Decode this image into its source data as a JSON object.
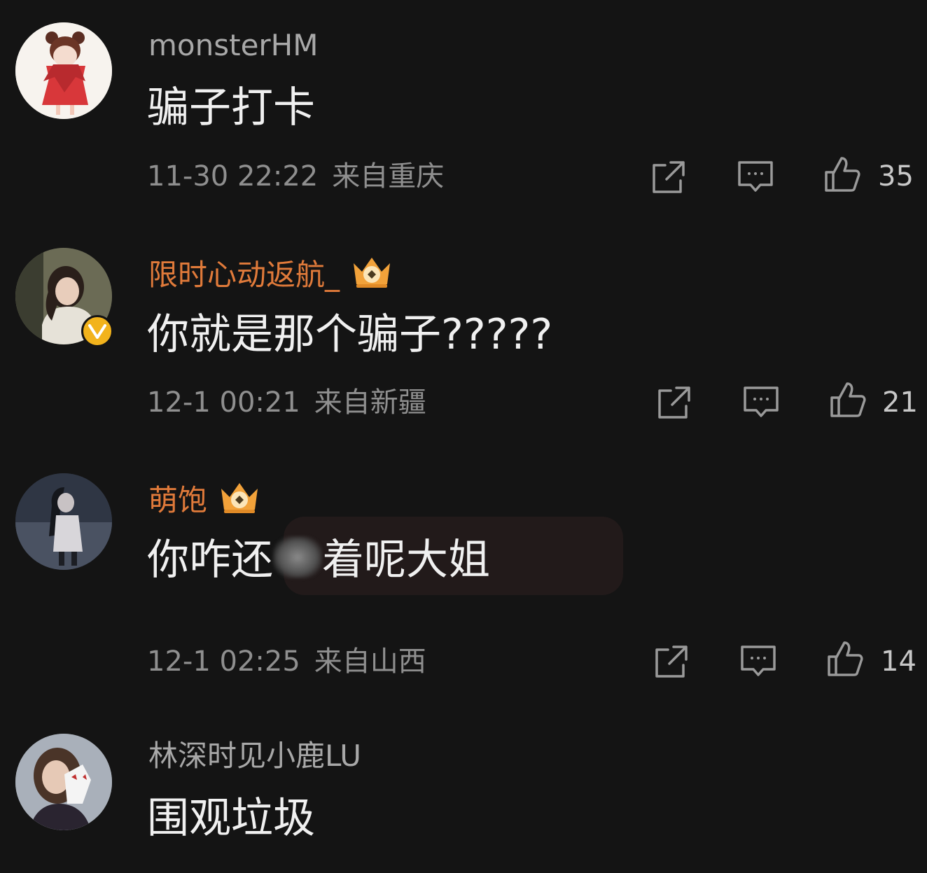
{
  "colors": {
    "background": "#141414",
    "name_default": "#a8a8a8",
    "name_vip": "#e07a3a",
    "text": "#f0f0f0",
    "meta": "#8f8f8f"
  },
  "comments": [
    {
      "username": "monsterHM",
      "vip": false,
      "verified": false,
      "text": "骗子打卡",
      "time": "11-30 22:22",
      "location": "来自重庆",
      "likes": "35"
    },
    {
      "username": "限时心动返航_",
      "vip": true,
      "verified": true,
      "text": "你就是那个骗子?????",
      "time": "12-1 00:21",
      "location": "来自新疆",
      "likes": "21"
    },
    {
      "username": "萌饱",
      "vip": true,
      "verified": false,
      "text_before_blur": "你咋还",
      "text_after_blur": "着呢大姐",
      "time": "12-1 02:25",
      "location": "来自山西",
      "likes": "14"
    },
    {
      "username": "林深时见小鹿LU",
      "vip": false,
      "verified": false,
      "text": "围观垃圾"
    }
  ],
  "icons": {
    "share": "share-icon",
    "reply": "comment-icon",
    "like": "thumbs-up-icon",
    "vip_badge": "crown-icon",
    "verified_badge": "verified-v-icon"
  }
}
